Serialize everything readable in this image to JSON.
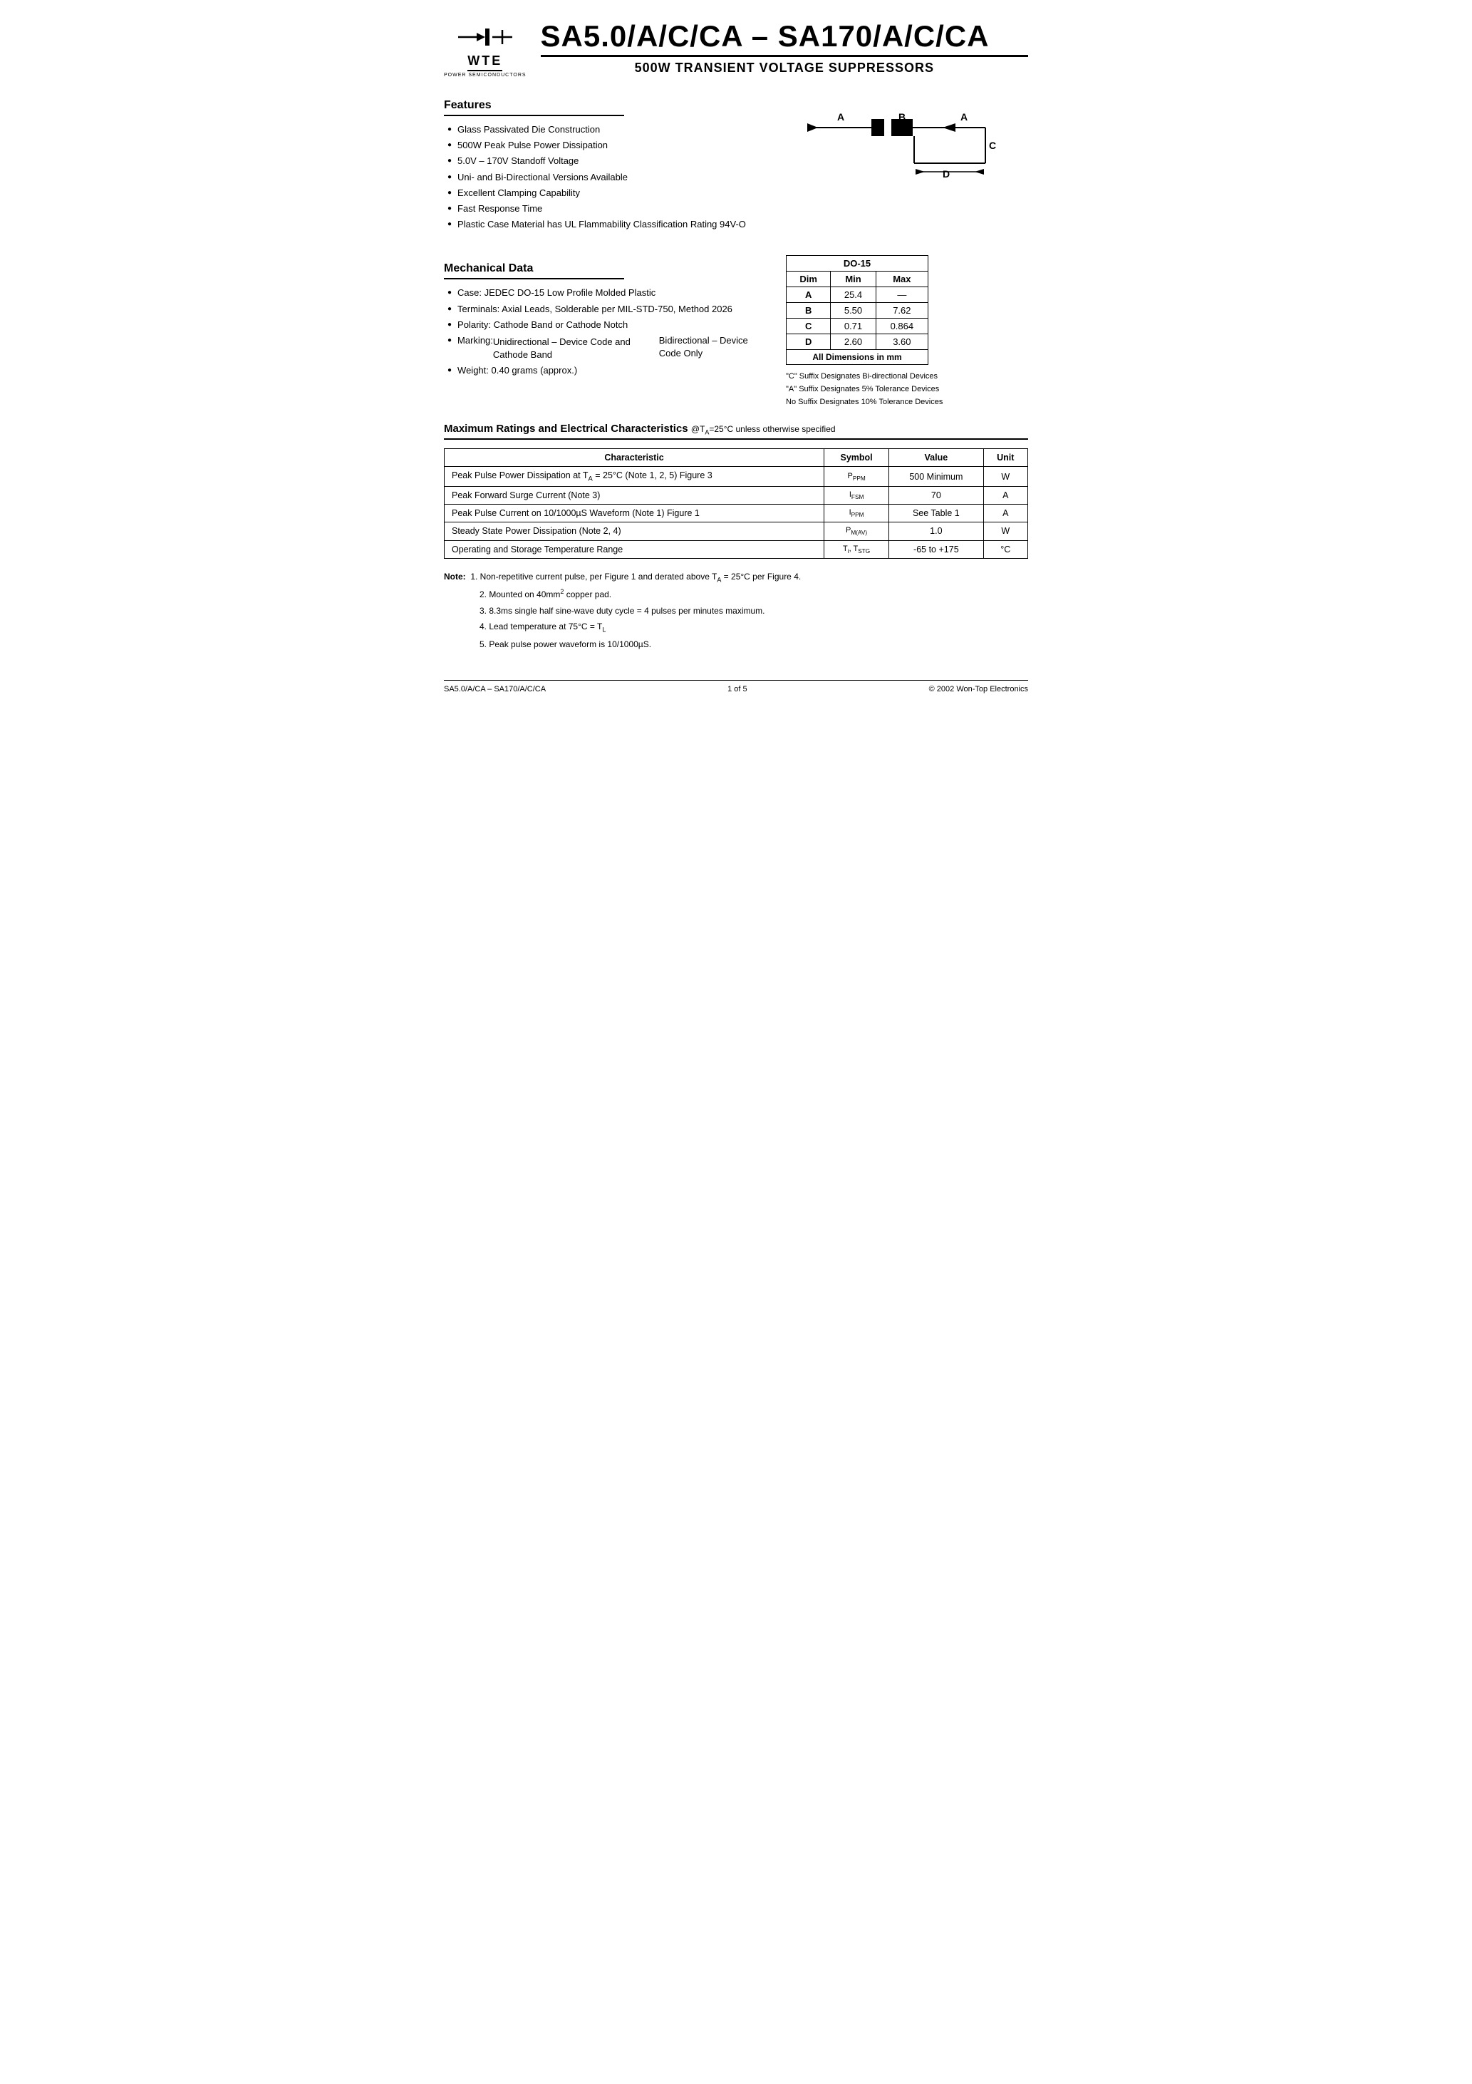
{
  "header": {
    "logo_wte": "WTE",
    "logo_sub": "POWER SEMICONDUCTORS",
    "main_title": "SA5.0/A/C/CA – SA170/A/C/CA",
    "sub_title": "500W TRANSIENT VOLTAGE SUPPRESSORS"
  },
  "features": {
    "section_title": "Features",
    "items": [
      "Glass Passivated Die Construction",
      "500W Peak Pulse Power Dissipation",
      "5.0V – 170V Standoff Voltage",
      "Uni- and Bi-Directional Versions Available",
      "Excellent Clamping Capability",
      "Fast Response Time",
      "Plastic Case Material has UL Flammability Classification Rating 94V-O"
    ]
  },
  "mechanical": {
    "section_title": "Mechanical Data",
    "items": [
      "Case: JEDEC DO-15 Low Profile Molded Plastic",
      "Terminals: Axial Leads, Solderable per MIL-STD-750, Method 2026",
      "Polarity: Cathode Band or Cathode Notch",
      "Marking:",
      "Unidirectional – Device Code and Cathode Band",
      "Bidirectional – Device Code Only",
      "Weight: 0.40 grams (approx.)"
    ]
  },
  "diagram": {
    "labels": [
      "A",
      "B",
      "A",
      "C",
      "D"
    ]
  },
  "dimensions": {
    "table_title": "DO-15",
    "headers": [
      "Dim",
      "Min",
      "Max"
    ],
    "rows": [
      {
        "dim": "A",
        "min": "25.4",
        "max": "—"
      },
      {
        "dim": "B",
        "min": "5.50",
        "max": "7.62"
      },
      {
        "dim": "C",
        "min": "0.71",
        "max": "0.864"
      },
      {
        "dim": "D",
        "min": "2.60",
        "max": "3.60"
      }
    ],
    "footer": "All Dimensions in mm"
  },
  "suffix_notes": {
    "lines": [
      "\"C\" Suffix Designates Bi-directional Devices",
      "\"A\" Suffix Designates 5% Tolerance Devices",
      "No Suffix Designates 10% Tolerance Devices"
    ]
  },
  "ratings": {
    "title": "Maximum Ratings and Electrical Characteristics",
    "condition": "@Tₐ=25°C unless otherwise specified",
    "headers": [
      "Characteristic",
      "Symbol",
      "Value",
      "Unit"
    ],
    "rows": [
      {
        "characteristic": "Peak Pulse Power Dissipation at Tₐ = 25°C (Note 1, 2, 5) Figure 3",
        "symbol": "PPPM",
        "value": "500 Minimum",
        "unit": "W"
      },
      {
        "characteristic": "Peak Forward Surge Current (Note 3)",
        "symbol": "IFSM",
        "value": "70",
        "unit": "A"
      },
      {
        "characteristic": "Peak Pulse Current on 10/1000µS Waveform (Note 1) Figure 1",
        "symbol": "IPPM",
        "value": "See Table 1",
        "unit": "A"
      },
      {
        "characteristic": "Steady State Power Dissipation (Note 2, 4)",
        "symbol": "PM(AV)",
        "value": "1.0",
        "unit": "W"
      },
      {
        "characteristic": "Operating and Storage Temperature Range",
        "symbol": "Ti, TSTG",
        "value": "-65 to +175",
        "unit": "°C"
      }
    ]
  },
  "notes": {
    "title": "Note:",
    "items": [
      "1. Non-repetitive current pulse, per Figure 1 and derated above Tₐ = 25°C per Figure 4.",
      "2. Mounted on 40mm² copper pad.",
      "3. 8.3ms single half sine-wave duty cycle = 4 pulses per minutes maximum.",
      "4. Lead temperature at 75°C = Tₗ",
      "5. Peak pulse power waveform is 10/1000µS."
    ]
  },
  "footer": {
    "left": "SA5.0/A/CA – SA170/A/C/CA",
    "center": "1 of 5",
    "right": "© 2002 Won-Top Electronics"
  }
}
